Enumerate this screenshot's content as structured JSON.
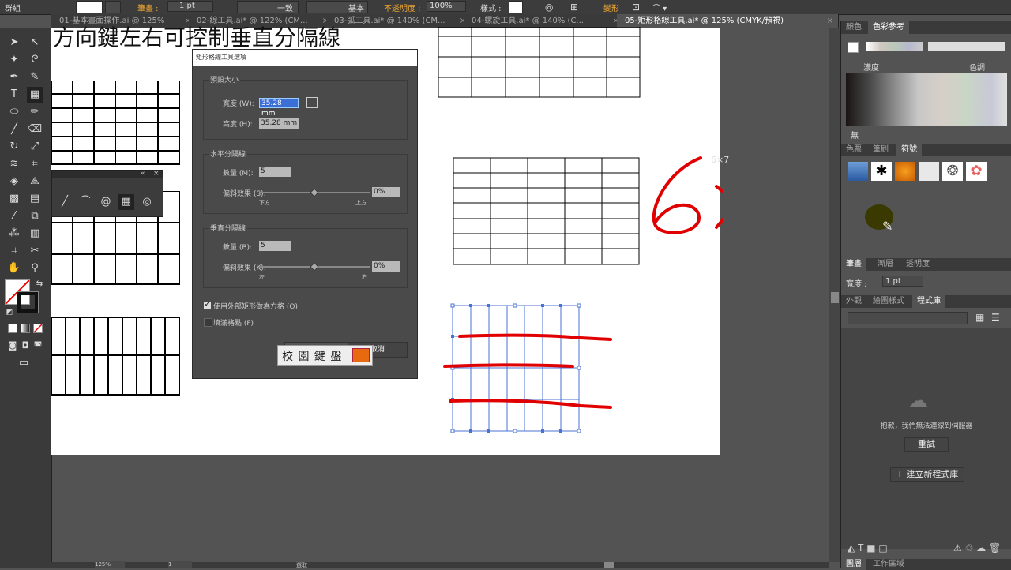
{
  "control_bar": {
    "panel_label": "群組",
    "stroke_label": "筆畫 :",
    "stroke_value": "1 pt",
    "uniform_label": "一致",
    "basic_label": "基本",
    "opacity_label": "不透明度 :",
    "opacity_value": "100%",
    "style_label": "樣式 :",
    "transform_label": "變形"
  },
  "tabs": [
    {
      "label": "01-基本畫面操作.ai @ 125%"
    },
    {
      "label": "02-線工具.ai* @ 122% (CM..."
    },
    {
      "label": "03-弧工具.ai* @ 140% (CM..."
    },
    {
      "label": "04-螺旋工具.ai* @ 140% (C..."
    },
    {
      "label": "05-矩形格線工具.ai* @ 125% (CMYK/預視)"
    }
  ],
  "artboard": {
    "heading": "方向鍵左右可控制垂直分隔線"
  },
  "dialog": {
    "title": "矩形格線工具選項",
    "default_size": "預設大小",
    "width_label": "寬度 (W):",
    "width_value": "35.28 mm",
    "height_label": "高度 (H):",
    "height_value": "35.28 mm",
    "horizontal_title": "水平分隔線",
    "h_count_label": "數量 (M):",
    "h_count_value": "5",
    "h_skew_label": "偏斜效果 (S):",
    "h_skew_value": "0%",
    "h_low": "下方",
    "h_high": "上方",
    "vertical_title": "垂直分隔線",
    "v_count_label": "數量 (B):",
    "v_count_value": "5",
    "v_skew_label": "偏斜效果 (K):",
    "v_skew_value": "0%",
    "v_low": "左",
    "v_high": "右",
    "use_outer_label": "使用外部矩形做為方格 (O)",
    "fill_grid_label": "填滿格點 (F)",
    "cancel_label": "取消"
  },
  "ime_bar": {
    "text": "校 園 鍵 盤"
  },
  "handwriting": {
    "text": "6×7"
  },
  "right_panel": {
    "tabs1": [
      "顏色",
      "色彩參考"
    ],
    "saturation_label": "濃度",
    "hue_label": "色調",
    "none_label": "無",
    "tabs2": [
      "色票",
      "筆刷",
      "符號"
    ],
    "tabs3": [
      "筆畫",
      "漸層",
      "透明度"
    ],
    "weight_label": "寬度 :",
    "weight_value": "1 pt",
    "tabs4": [
      "外觀",
      "繪圖樣式",
      "程式庫"
    ],
    "cc_message": "抱歉，我們無法連線到伺服器",
    "retry_label": "重試",
    "new_library_label": "+ 建立新程式庫",
    "bottom_tabs": [
      "圖層",
      "工作區域"
    ]
  },
  "status_bar": {
    "zoom": "125%",
    "page": "1",
    "tool_status": "選取"
  },
  "colors": {
    "accent_red": "#e00000",
    "selection_blue": "#4a72d6"
  }
}
